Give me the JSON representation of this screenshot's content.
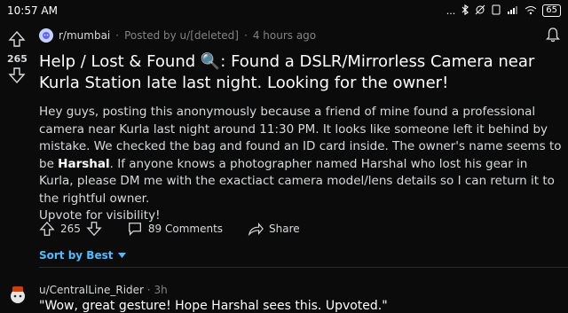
{
  "status_bar": {
    "time": "10:57 AM",
    "dots": "...",
    "bluetooth_icon": "bluetooth-icon",
    "dnd_icon": "muted-alarm-icon",
    "sim_icon": "sim-icon",
    "signal_icon": "signal-icon",
    "wifi_icon": "wifi-icon",
    "battery": "65"
  },
  "post": {
    "upvotes": "265",
    "subreddit": "r/mumbai",
    "posted_by": "Posted by u/[deleted]",
    "age": "4 hours ago",
    "title": "Help / Lost & Found 🔍: Found a DSLR/Mirrorless Camera near Kurla Station late last night. Looking for the owner!",
    "body_1": "Hey guys, posting this anonymously because a friend of mine found a professional camera near Kurla last night around 11:30 PM. It looks like someone left it behind by mistake. We checked the bag and found an ID card inside. The owner's name seems to be ",
    "body_name": "Harshal",
    "body_2": ". If anyone knows a photographer named Harshal who lost his gear in Kurla, please DM me with the exactiact camera model/lens details so I can return it to the rightful owner.",
    "body_3": "Upvote for visibility!",
    "action_votes": "265",
    "comments": "89 Comments",
    "share": "Share",
    "sort": "Sort by Best"
  },
  "comment": {
    "user": "u/CentralLine_Rider",
    "age": "3h",
    "text": "\"Wow, great gesture! Hope Harshal sees this. Upvoted.\""
  },
  "colors": {
    "background": "#0b0b0b",
    "accent": "#4fbcff",
    "muted": "#818384"
  }
}
